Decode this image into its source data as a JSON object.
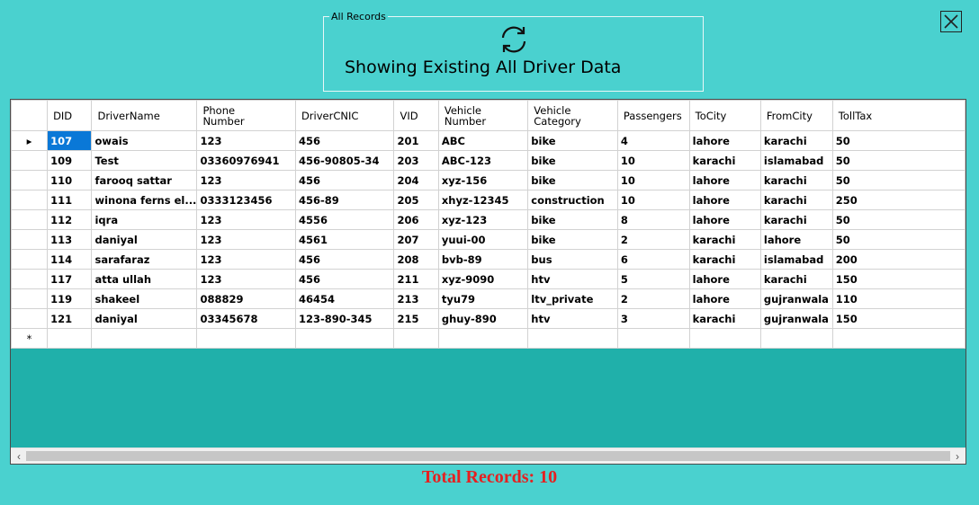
{
  "groupbox": {
    "title": "All Records"
  },
  "heading": "Showing Existing All Driver Data",
  "icons": {
    "refresh": "refresh-icon",
    "close": "close-icon",
    "current_row": "row-pointer-icon",
    "new_row": "asterisk-icon"
  },
  "grid": {
    "columns": [
      "DID",
      "DriverName",
      "Phone\nNumber",
      "DriverCNIC",
      "VID",
      "Vehicle\nNumber",
      "Vehicle\nCategory",
      "Passengers",
      "ToCity",
      "FromCity",
      "TollTax"
    ],
    "rows": [
      [
        "107",
        "owais",
        "123",
        "456",
        "201",
        "ABC",
        "bike",
        "4",
        "lahore",
        "karachi",
        "50"
      ],
      [
        "109",
        "Test",
        "03360976941",
        "456-90805-34",
        "203",
        "ABC-123",
        "bike",
        "10",
        "karachi",
        "islamabad",
        "50"
      ],
      [
        "110",
        "farooq sattar",
        "123",
        "456",
        "204",
        "xyz-156",
        "bike",
        "10",
        "lahore",
        "karachi",
        "50"
      ],
      [
        "111",
        "winona ferns el...",
        "0333123456",
        "456-89",
        "205",
        "xhyz-12345",
        "construction",
        "10",
        "lahore",
        "karachi",
        "250"
      ],
      [
        "112",
        "iqra",
        "123",
        "4556",
        "206",
        "xyz-123",
        "bike",
        "8",
        "lahore",
        "karachi",
        "50"
      ],
      [
        "113",
        "daniyal",
        "123",
        "4561",
        "207",
        "yuui-00",
        "bike",
        "2",
        "karachi",
        "lahore",
        "50"
      ],
      [
        "114",
        "sarafaraz",
        "123",
        "456",
        "208",
        "bvb-89",
        "bus",
        "6",
        "karachi",
        "islamabad",
        "200"
      ],
      [
        "117",
        "atta ullah",
        "123",
        "456",
        "211",
        "xyz-9090",
        "htv",
        "5",
        "lahore",
        "karachi",
        "150"
      ],
      [
        "119",
        "shakeel",
        "088829",
        "46454",
        "213",
        "tyu79",
        "ltv_private",
        "2",
        "lahore",
        "gujranwala",
        "110"
      ],
      [
        "121",
        "daniyal",
        "03345678",
        "123-890-345",
        "215",
        "ghuy-890",
        "htv",
        "3",
        "karachi",
        "gujranwala",
        "150"
      ]
    ],
    "selected_cell": {
      "row": 0,
      "column": 0
    },
    "row_header": {
      "current_marker": "▸",
      "new_row_marker": "*"
    }
  },
  "total_records": "Total Records: 10",
  "colors": {
    "background": "#4ad1cf",
    "grid_background": "#20b0aa",
    "selection": "#0a78d7",
    "total_text": "#e52020"
  }
}
